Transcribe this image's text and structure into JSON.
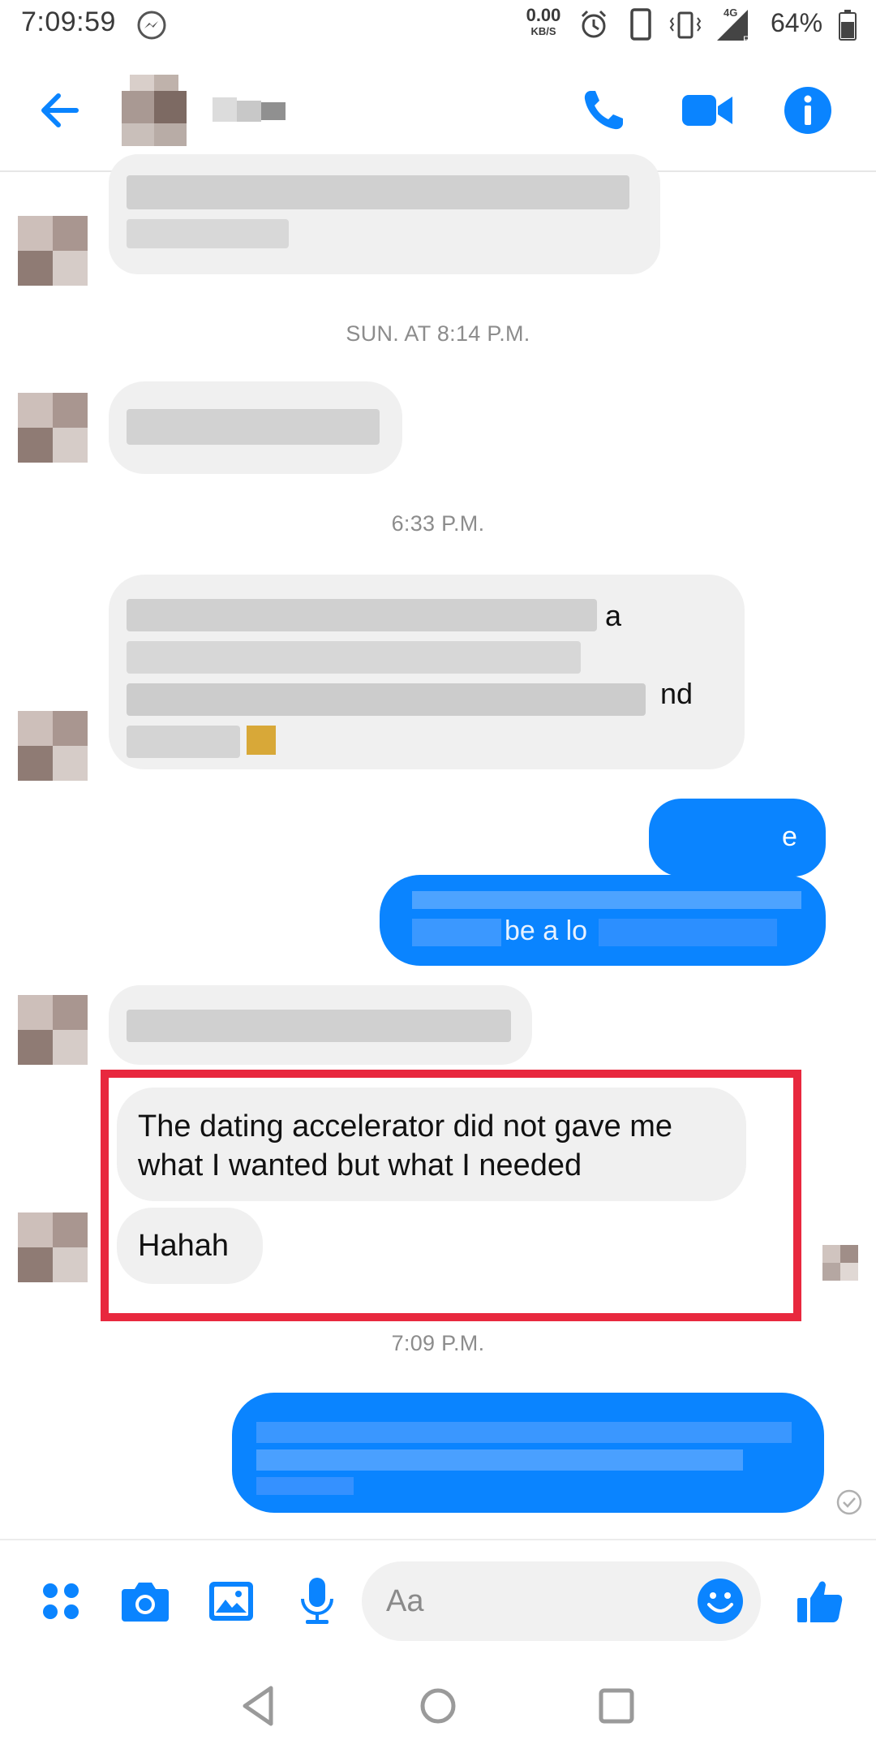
{
  "status_bar": {
    "time": "7:09:59",
    "net_speed_value": "0.00",
    "net_speed_unit": "KB/S",
    "network_type": "4G",
    "battery": "64%"
  },
  "header": {
    "icons": [
      "arrow-left-icon",
      "phone-icon",
      "video-camera-icon",
      "info-icon"
    ]
  },
  "chat": {
    "timestamps": [
      "SUN. AT 8:14 P.M.",
      "6:33 P.M.",
      "7:09 P.M."
    ],
    "partial_fragments": [
      "a",
      "nd",
      "e",
      "be a lo"
    ],
    "highlighted_messages": [
      "The dating accelerator did not gave me what I wanted but what I needed",
      "Hahah"
    ]
  },
  "composer": {
    "placeholder": "Aa",
    "icons": [
      "apps-icon",
      "camera-icon",
      "gallery-icon",
      "microphone-icon",
      "emoji-icon",
      "thumbs-up-icon"
    ]
  },
  "colors": {
    "accent": "#0a84ff",
    "highlight_border": "#e8283e",
    "incoming_bubble": "#f0f0f0"
  }
}
